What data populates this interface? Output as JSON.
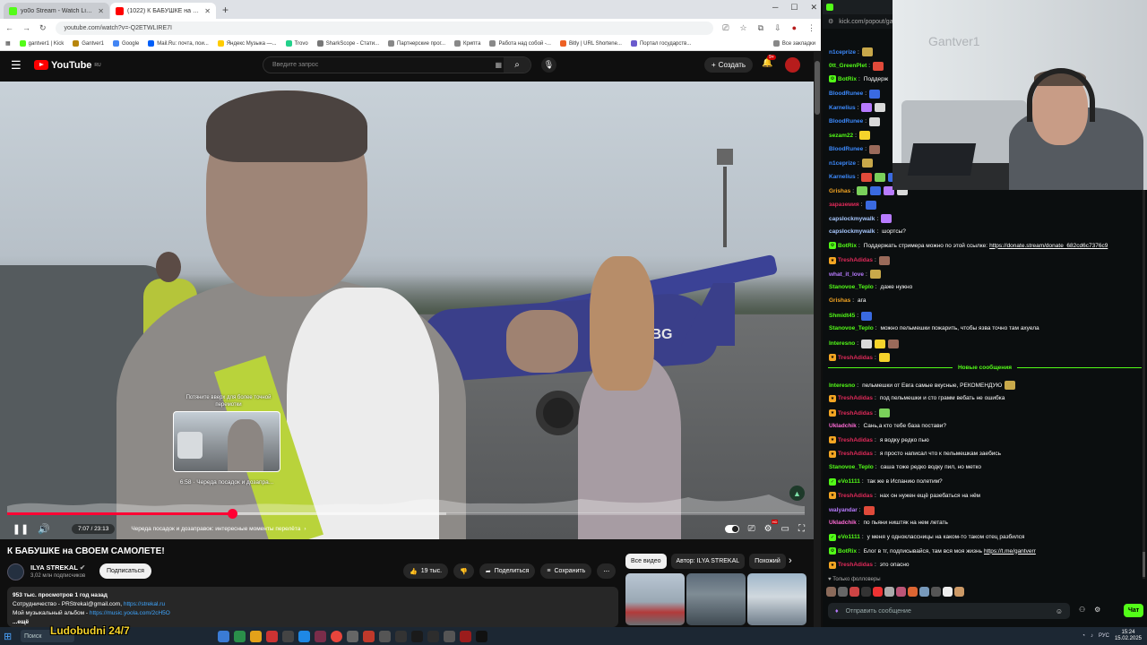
{
  "browser": {
    "tabs": [
      {
        "title": "yo0o Stream - Watch Live on Ki",
        "color": "#53fc18",
        "active": false
      },
      {
        "title": "(1022) К БАБУШКЕ на СВО",
        "color": "#ff0000",
        "active": true
      }
    ],
    "url": "youtube.com/watch?v=-Q2ETWLIRE7I",
    "bookmarks": [
      "gantver1 | Kick",
      "Gantver1",
      "Google",
      "Mail.Ru: почта, пои...",
      "Яндекс Музыка —...",
      "Trovo",
      "SharkScope - Стати...",
      "Партнерские прог...",
      "Крипта",
      "Работа над собой -...",
      "Bitly | URL Shortene...",
      "Портал государств..."
    ],
    "all_bookmarks": "Все закладки"
  },
  "youtube": {
    "logo": "YouTube",
    "region": "RU",
    "search_placeholder": "Введите запрос",
    "create_label": "Создать",
    "notif_count": "9+",
    "video": {
      "plane_reg": "0BBG",
      "scrub_hint": "Потяните вверх для более точной перемотки",
      "preview_label": "6:58 · Череда посадок и дозапра...",
      "time": "7:07 / 23:13",
      "chapter": "Череда посадок и дозаправок: интересные моменты перелёта",
      "progress": {
        "played": 0.2825,
        "buffered": 0.55
      }
    },
    "title": "К БАБУШКЕ на СВОЕМ САМОЛЕТЕ!",
    "channel": {
      "name": "ILYA STREKAL",
      "subs": "3,02 млн подписчиков"
    },
    "subscribe": "Подписаться",
    "actions": {
      "likes": "19 тыс.",
      "share": "Поделиться",
      "save": "Сохранить"
    },
    "description": {
      "meta": "953 тыс. просмотров  1 год назад",
      "line1": "Сотрудничество - PRStrekal@gmail.com,",
      "line1_link": "https://strekal.ru",
      "line2": "Мой музыкальный альбом -",
      "line2_link": "https://music.yoola.com/2cH5O",
      "more": "...ещё"
    },
    "chips": [
      "Все видео",
      "Автор: ILYA STREKAL",
      "Похожий"
    ]
  },
  "kick": {
    "url": "kick.com/popout/gantver",
    "webcam_text": "Gantver1",
    "messages": [
      {
        "user": "n1ceprize",
        "color": "#3d8bff",
        "text": "",
        "badge": "",
        "emotes": 1
      },
      {
        "user": "0tt_GreenPlet",
        "color": "#53fc18",
        "text": "",
        "badge": "",
        "emotes": 1
      },
      {
        "user": "BotRix",
        "color": "#53fc18",
        "text": "Поддерж",
        "badge": "bot",
        "emotes": 0
      },
      {
        "user": "BloodRunee",
        "color": "#3d8bff",
        "text": "",
        "badge": "",
        "emotes": 1
      },
      {
        "user": "Karnelius",
        "color": "#3d8bff",
        "text": "",
        "badge": "",
        "emotes": 2
      },
      {
        "user": "BloodRunee",
        "color": "#3d8bff",
        "text": "",
        "badge": "",
        "emotes": 1
      },
      {
        "user": "sezam22",
        "color": "#53fc18",
        "text": "",
        "badge": "",
        "emotes": 1
      },
      {
        "user": "BloodRunee",
        "color": "#3d8bff",
        "text": "",
        "badge": "",
        "emotes": 1
      },
      {
        "user": "n1ceprize",
        "color": "#3d8bff",
        "text": "",
        "badge": "",
        "emotes": 1
      },
      {
        "user": "Karnelius",
        "color": "#3d8bff",
        "text": "",
        "badge": "",
        "emotes": 3
      },
      {
        "user": "Grishas",
        "color": "#f5a623",
        "text": "",
        "badge": "",
        "emotes": 4
      },
      {
        "user": "зараземия",
        "color": "#e02a5a",
        "text": "",
        "badge": "",
        "emotes": 1
      },
      {
        "user": "capslockmywalk",
        "color": "#a8c8ff",
        "text": "",
        "badge": "",
        "emotes": 1
      },
      {
        "user": "capslockmywalk",
        "color": "#a8c8ff",
        "text": "шортсы?",
        "badge": "",
        "emotes": 0
      },
      {
        "user": "BotRix",
        "color": "#53fc18",
        "text": "Поддержать стримера можно по этой ссылке: ",
        "link": "https://donate.stream/donate_682cd6c7376c9",
        "badge": "bot",
        "emotes": 0
      },
      {
        "user": "TreshAdidas",
        "color": "#e02a5a",
        "text": "",
        "badge": "sub",
        "emotes": 1
      },
      {
        "user": "what_it_love",
        "color": "#b87bff",
        "text": "",
        "badge": "",
        "emotes": 1
      },
      {
        "user": "Stanovoe_Teplo",
        "color": "#53fc18",
        "text": "даже нужно",
        "badge": "",
        "emotes": 0
      },
      {
        "user": "Grishas",
        "color": "#f5a623",
        "text": "ага",
        "badge": "",
        "emotes": 0
      },
      {
        "user": "Shmidt45",
        "color": "#53fc18",
        "text": "",
        "badge": "",
        "emotes": 1
      },
      {
        "user": "Stanovoe_Teplo",
        "color": "#53fc18",
        "text": "можно пельмешки пожарить, чтобы язва точно там ахуела",
        "badge": "",
        "emotes": 0
      },
      {
        "user": "Interesno",
        "color": "#53fc18",
        "text": "",
        "badge": "",
        "emotes": 3
      },
      {
        "user": "TreshAdidas",
        "color": "#e02a5a",
        "text": "",
        "badge": "sub",
        "emotes": 1
      }
    ],
    "new_messages_label": "Новые сообщения",
    "messages2": [
      {
        "user": "Interesno",
        "color": "#53fc18",
        "text": "пельмешки от Евга самые вкусные, РЕКОМЕНДУЮ",
        "badge": "",
        "emotes": 1
      },
      {
        "user": "TreshAdidas",
        "color": "#e02a5a",
        "text": "под пельмешки и сто грамм вебать не ошибка",
        "badge": "sub",
        "emotes": 0
      },
      {
        "user": "TreshAdidas",
        "color": "#e02a5a",
        "text": "",
        "badge": "sub",
        "emotes": 1
      },
      {
        "user": "Ukladchik",
        "color": "#ff6bd6",
        "text": "Сань,а кто тебе база постави?",
        "badge": "",
        "emotes": 0
      },
      {
        "user": "TreshAdidas",
        "color": "#e02a5a",
        "text": "я водку редко пью",
        "badge": "sub",
        "emotes": 0
      },
      {
        "user": "TreshAdidas",
        "color": "#e02a5a",
        "text": "я просто написал что к пельмешкам заебись",
        "badge": "sub",
        "emotes": 0
      },
      {
        "user": "Stanovoe_Teplo",
        "color": "#53fc18",
        "text": "саша тоже редко водку пил, но метко",
        "badge": "",
        "emotes": 0
      },
      {
        "user": "eVo1111",
        "color": "#53fc18",
        "text": "так же в Испанию полетим?",
        "badge": "verified",
        "emotes": 0
      },
      {
        "user": "TreshAdidas",
        "color": "#e02a5a",
        "text": "нах он нужен ещё разебаться на нём",
        "badge": "sub",
        "emotes": 0
      },
      {
        "user": "walyandar",
        "color": "#b87bff",
        "text": "",
        "badge": "",
        "emotes": 1
      },
      {
        "user": "Ukladchik",
        "color": "#ff6bd6",
        "text": "по пьяни ништяк на нем летать",
        "badge": "",
        "emotes": 0
      },
      {
        "user": "eVo1111",
        "color": "#53fc18",
        "text": "у меня у одноклассницы на каком-то таком отец разбился",
        "badge": "verified",
        "emotes": 0
      },
      {
        "user": "BotRix",
        "color": "#53fc18",
        "text": "Блог в тг, подписывайся, там вся моя жизнь ",
        "link": "https://t.me/gantverr",
        "badge": "bot",
        "emotes": 0
      },
      {
        "user": "TreshAdidas",
        "color": "#e02a5a",
        "text": "это опасно",
        "badge": "sub",
        "emotes": 0
      }
    ],
    "followers_only": "Только фолловеры",
    "input_placeholder": "Отправить сообщение",
    "chat_button": "Чат"
  },
  "taskbar": {
    "search": "Поиск",
    "overlay": "Ludobudni 24/7",
    "lang": "РУС",
    "time": "15:24",
    "date": "15.02.2025"
  }
}
